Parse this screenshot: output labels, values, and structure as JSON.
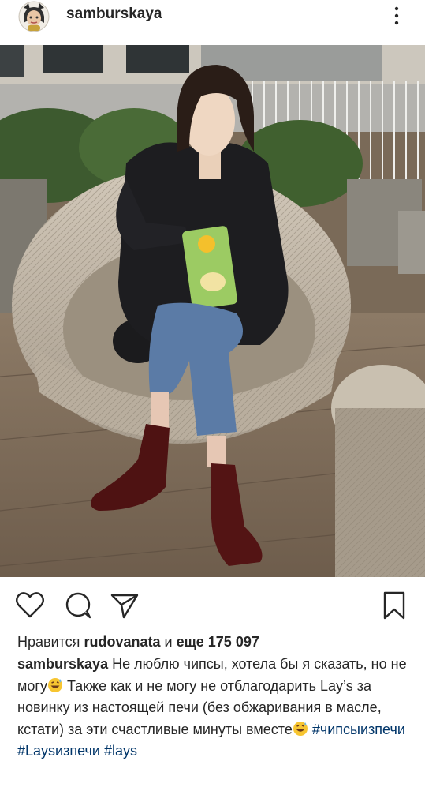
{
  "post": {
    "username": "samburskaya",
    "likes": {
      "prefix": "Нравится",
      "user": "rudovanata",
      "connector": "и",
      "others": "еще 175 097"
    },
    "caption": {
      "username": "samburskaya",
      "part1": "Не люблю чипсы, хотела бы я сказать, но не могу",
      "part2": " Также как и не могу не отблагодарить Lay’s за новинку из настоящей печи (без обжаривания в масле, кстати) за эти счастливые минуты вместе",
      "hashtags": [
        "#чипсыизпечи",
        "#Laysизпечи",
        "#lays"
      ]
    }
  },
  "icons": {
    "avatar": "avatar",
    "more": "more-vertical-icon",
    "like": "heart-icon",
    "comment": "comment-icon",
    "share": "paper-plane-icon",
    "save": "bookmark-icon",
    "emoji": "grinning-sweat-emoji"
  },
  "colors": {
    "text": "#262626",
    "hashtag": "#003569"
  }
}
